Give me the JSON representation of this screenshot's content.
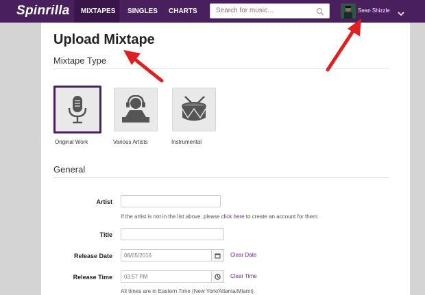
{
  "nav": {
    "logo": "Spinrilla",
    "links": [
      {
        "label": "MIXTAPES",
        "active": true
      },
      {
        "label": "SINGLES",
        "active": false
      },
      {
        "label": "CHARTS",
        "active": false
      }
    ],
    "search_placeholder": "Search for music...",
    "username": "Sean Shizzle"
  },
  "page": {
    "title": "Upload Mixtape",
    "mixtape_type_heading": "Mixtape Type",
    "types": [
      {
        "label": "Original Work",
        "icon": "microphone-icon",
        "selected": true
      },
      {
        "label": "Various Artists",
        "icon": "dj-headphones-icon",
        "selected": false
      },
      {
        "label": "Instrumental",
        "icon": "drum-icon",
        "selected": false
      }
    ],
    "general_heading": "General"
  },
  "form": {
    "artist_label": "Artist",
    "artist_value": "",
    "artist_help_prefix": "If the artist is not in the list above, please ",
    "artist_help_link": "click here",
    "artist_help_suffix": " to create an account for them.",
    "title_label": "Title",
    "title_value": "",
    "release_date_label": "Release Date",
    "release_date_value": "08/05/2016",
    "clear_date": "Clear Date",
    "release_time_label": "Release Time",
    "release_time_value": "03:57 PM",
    "clear_time": "Clear Time",
    "timezone_note": "All times are in Eastern Time (New York/Atlanta/Miami)."
  },
  "colors": {
    "brand": "#4a1f5e",
    "link": "#6b2c91",
    "annotation": "#e02020"
  }
}
